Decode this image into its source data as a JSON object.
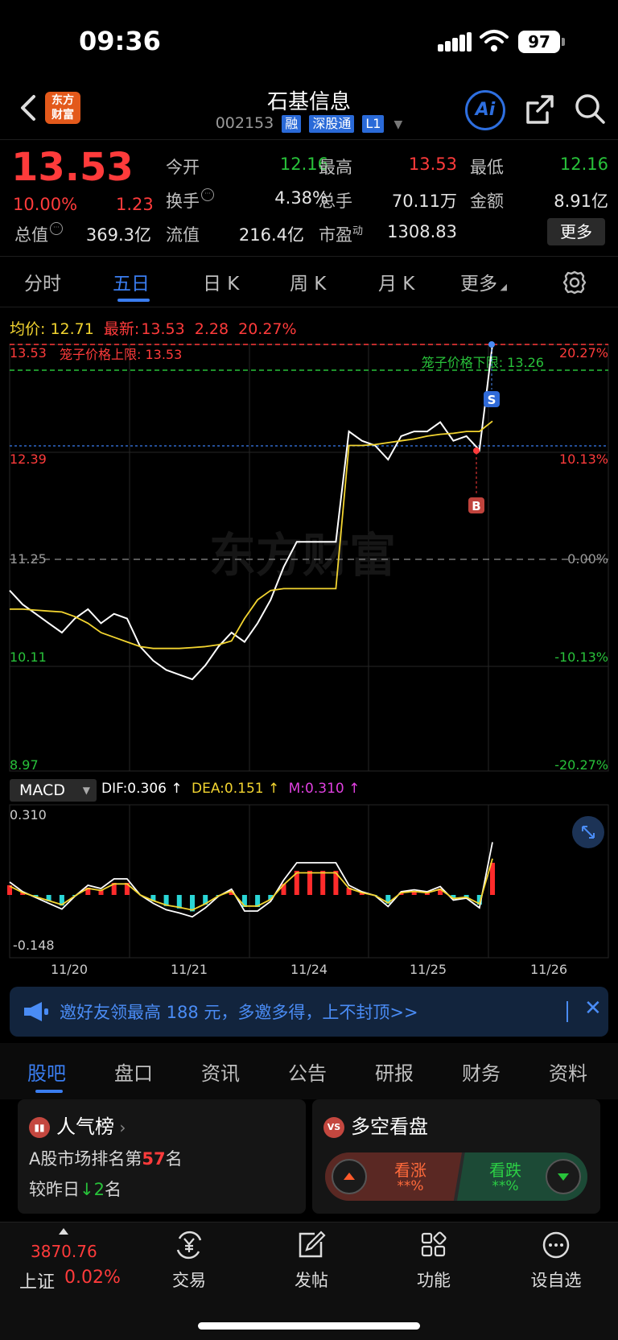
{
  "status_bar": {
    "time": "09:36",
    "battery": "97"
  },
  "nav": {
    "logo_line1": "东方",
    "logo_line2": "财富",
    "title": "石基信息",
    "code": "002153",
    "tags": [
      "融",
      "深股通",
      "L1"
    ],
    "ai_label": "Ai"
  },
  "quote": {
    "price": "13.53",
    "change_pct": "10.00%",
    "change": "1.23",
    "fields": [
      {
        "label": "今开",
        "value": "12.16",
        "color": "#28c23a"
      },
      {
        "label": "最高",
        "value": "13.53",
        "color": "#ff3b3b"
      },
      {
        "label": "最低",
        "value": "12.16",
        "color": "#28c23a"
      },
      {
        "label": "换手",
        "value": "4.38%",
        "color": "#e6e6e6"
      },
      {
        "label": "总手",
        "value": "70.11万",
        "color": "#e6e6e6"
      },
      {
        "label": "金额",
        "value": "8.91亿",
        "color": "#e6e6e6"
      },
      {
        "label": "总值",
        "value": "369.3亿",
        "color": "#e6e6e6"
      },
      {
        "label": "流值",
        "value": "216.4亿",
        "color": "#e6e6e6"
      },
      {
        "label": "市盈",
        "value": "1308.83",
        "color": "#e6e6e6"
      }
    ],
    "pe_superscript": "动",
    "more_label": "更多"
  },
  "chart_tabs": [
    "分时",
    "五日",
    "日 K",
    "周 K",
    "月 K",
    "更多"
  ],
  "active_chart_tab": "五日",
  "legend": {
    "avg_label": "均价:",
    "avg_value": "12.71",
    "latest_label": "最新:",
    "latest_value": "13.53",
    "latest_change": "2.28",
    "latest_pct": "20.27%"
  },
  "price_chart": {
    "y_left": [
      "13.53",
      "12.39",
      "11.25",
      "10.11",
      "8.97"
    ],
    "y_right": [
      "20.27%",
      "10.13%",
      "0.00%",
      "-10.13%",
      "-20.27%"
    ],
    "cage_upper": "笼子价格上限: 13.53",
    "cage_lower": "笼子价格下限: 13.26",
    "sell_marker": "S",
    "buy_marker": "B",
    "watermark": "东方财富",
    "colors": {
      "price_line": "#ffffff",
      "avg_line": "#f2d430",
      "up": "#ff3b3b",
      "down": "#28c23a"
    }
  },
  "chart_data": {
    "type": "line",
    "x_labels": [
      "11/20",
      "11/21",
      "11/24",
      "11/25",
      "11/26"
    ],
    "ylim": [
      8.97,
      13.53
    ],
    "reference": 11.25,
    "series": [
      {
        "values": [
          10.9,
          10.75,
          10.65,
          10.55,
          10.45,
          10.6,
          10.7,
          10.55,
          10.65,
          10.6,
          10.3,
          10.15,
          10.05,
          10.0,
          9.95,
          10.1,
          10.3,
          10.45,
          10.35,
          10.55,
          10.8,
          11.15,
          11.42,
          11.42,
          11.42,
          11.42,
          12.6,
          12.5,
          12.45,
          12.3,
          12.55,
          12.6,
          12.6,
          12.7,
          12.5,
          12.55,
          12.4,
          13.53
        ]
      },
      {
        "values": [
          10.7,
          10.7,
          10.69,
          10.68,
          10.67,
          10.62,
          10.55,
          10.45,
          10.4,
          10.35,
          10.3,
          10.28,
          10.28,
          10.28,
          10.29,
          10.3,
          10.32,
          10.36,
          10.6,
          10.8,
          10.9,
          10.92,
          10.92,
          10.92,
          10.92,
          10.92,
          12.45,
          12.45,
          12.46,
          12.48,
          12.5,
          12.52,
          12.55,
          12.57,
          12.58,
          12.6,
          12.6,
          12.71
        ]
      }
    ]
  },
  "macd": {
    "selector": "MACD",
    "dif": "DIF:0.306 ↑",
    "dea": "DEA:0.151 ↑",
    "m": "M:0.310 ↑",
    "top": "0.310",
    "bottom": "-0.148",
    "colors": {
      "dif": "#ffffff",
      "dea": "#f2d430",
      "m": "#e040e0",
      "pos": "#ff2b2b",
      "neg": "#2ad6d6"
    }
  },
  "banner": {
    "text": "邀好友领最高 188 元，多邀多得，上不封顶>>"
  },
  "bottom_tabs": [
    "股吧",
    "盘口",
    "资讯",
    "公告",
    "研报",
    "财务",
    "资料"
  ],
  "active_bottom_tab": "股吧",
  "popularity": {
    "title": "人气榜",
    "rank_prefix": "A股市场排名第",
    "rank": "57",
    "rank_suffix": "名",
    "change_prefix": "较昨日",
    "change_arrow": "↓",
    "change_value": "2",
    "change_suffix": "名"
  },
  "sentiment": {
    "title": "多空看盘",
    "up_label": "看涨",
    "up_pct": "**%",
    "down_label": "看跌",
    "down_pct": "**%"
  },
  "bottom_bar": {
    "index_value": "3870.76",
    "index_name": "上证",
    "index_pct": "0.02%",
    "items": [
      "交易",
      "发帖",
      "功能",
      "设自选"
    ]
  }
}
